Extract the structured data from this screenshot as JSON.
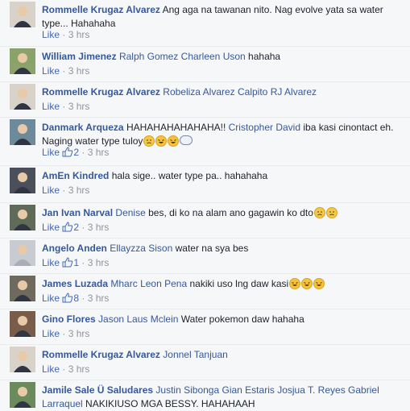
{
  "like_label": "Like",
  "comments": [
    {
      "author": "Rommelle Krugaz Alvarez",
      "mentions": [],
      "text": "Ang aga na tawanan nito. Nag evolve yata sa water type... Hahahaha",
      "emojis": [],
      "likes": "",
      "time": "3 hrs"
    },
    {
      "author": "William Jimenez",
      "mentions": [
        "Ralph Gomez",
        "Charleen Uson"
      ],
      "text": "hahaha",
      "emojis": [],
      "likes": "",
      "time": "3 hrs"
    },
    {
      "author": "Rommelle Krugaz Alvarez",
      "mentions": [
        "Robeliza Alvarez Calpito",
        "RJ Alvarez"
      ],
      "text": "",
      "emojis": [],
      "likes": "",
      "time": "3 hrs"
    },
    {
      "author": "Danmark Arqueza",
      "mentions": [],
      "text": "HAHAHAHAHAHAHA!! ",
      "mention_inline": "Cristopher David",
      "text2": "iba kasi cinontact eh. Naging water type tuloy",
      "emojis": [
        "sad",
        "laugh",
        "laugh",
        "bubble"
      ],
      "likes": "2",
      "time": "3 hrs"
    },
    {
      "author": "AmEn Kindred",
      "mentions": [],
      "text": "hala sige.. water type pa.. hahahaha",
      "emojis": [],
      "likes": "",
      "time": "3 hrs"
    },
    {
      "author": "Jan Ivan Narval",
      "mentions": [
        "Denise"
      ],
      "text": "bes, di ko na alam ano gagawin ko dto",
      "emojis": [
        "sad",
        "sad"
      ],
      "likes": "2",
      "time": "3 hrs"
    },
    {
      "author": "Angelo Anden",
      "mentions": [
        "Ellayzza Sison"
      ],
      "text": "water na sya bes",
      "emojis": [],
      "likes": "1",
      "time": "3 hrs"
    },
    {
      "author": "James Luzada",
      "mentions": [
        "Mharc Leon Pena"
      ],
      "text": "nakiki uso lng daw kasi",
      "emojis": [
        "laugh",
        "laugh",
        "laugh"
      ],
      "likes": "8",
      "time": "3 hrs"
    },
    {
      "author": "Gino Flores",
      "mentions": [
        "Jason Laus Mclein"
      ],
      "text": "Water pokemon daw hahaha",
      "emojis": [],
      "likes": "",
      "time": "3 hrs"
    },
    {
      "author": "Rommelle Krugaz Alvarez",
      "mentions": [
        "Jonnel Tanjuan"
      ],
      "text": "",
      "emojis": [],
      "likes": "",
      "time": "3 hrs"
    },
    {
      "author": "Jamile Sale Ü Saludares",
      "mentions": [
        "Justin Sibonga",
        "Gian Estaris",
        "Josjua T. Reyes",
        "Gabriel Larraquel"
      ],
      "text": "NAKIKIUSO MGA BESSY. HAHAHAAH",
      "emojis": [],
      "likes": "",
      "time": ""
    }
  ],
  "colors": {
    "link": "#365899",
    "like": "#4267b2",
    "meta": "#90949c",
    "bg": "#f6f7f9"
  }
}
